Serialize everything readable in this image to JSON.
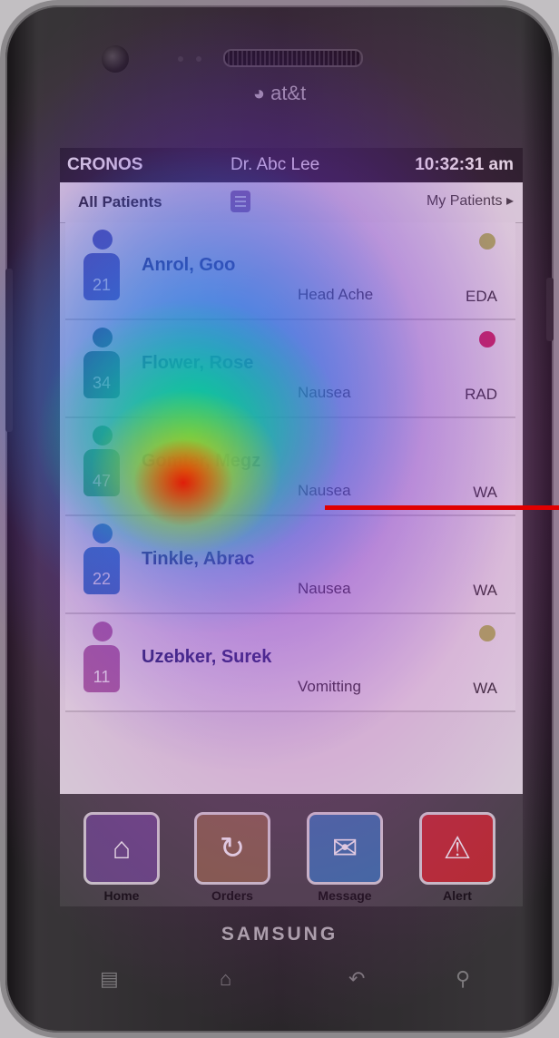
{
  "device": {
    "carrier": "at&t",
    "brand": "SAMSUNG"
  },
  "status_bar": {
    "app_name": "CRONOS",
    "doctor": "Dr. Abc Lee",
    "time": "10:32:31 am"
  },
  "tabs": {
    "all": "All Patients",
    "mine": "My Patients ▸"
  },
  "patients": [
    {
      "name": "Anrol, Goo",
      "number": "21",
      "complaint": "Head Ache",
      "dept": "EDA",
      "status_color": "#b8c05a",
      "avatar_color": "#4a57b8"
    },
    {
      "name": "Flower, Rose",
      "number": "34",
      "complaint": "Nausea",
      "dept": "RAD",
      "status_color": "#d8245a",
      "avatar_color": "#1d6a6e"
    },
    {
      "name": "Gomter, Megz",
      "number": "47",
      "complaint": "Nausea",
      "dept": "WA",
      "status_color": "",
      "avatar_color": "#2fa458"
    },
    {
      "name": "Tinkle, Abrac",
      "number": "22",
      "complaint": "Nausea",
      "dept": "WA",
      "status_color": "",
      "avatar_color": "#2d7ac8"
    },
    {
      "name": "Uzebker, Surek",
      "number": "11",
      "complaint": "Vomitting",
      "dept": "WA",
      "status_color": "#b8c05a",
      "avatar_color": "#b06aa8"
    }
  ],
  "nav": {
    "home": "Home",
    "orders": "Orders",
    "message": "Message",
    "alert": "Alert"
  },
  "colors": {
    "status_bar_bg": "#222222",
    "footer_bg": "#4a4a4a",
    "home_tile": "#6b4f8a",
    "orders_tile": "#8a6a4a",
    "message_tile": "#3a7ab0",
    "alert_tile": "#c83030",
    "marker": "#e00000"
  },
  "icons": {
    "home": "house-icon",
    "orders": "refresh-arrows-icon",
    "message": "envelope-icon",
    "alert": "warning-triangle-icon"
  }
}
